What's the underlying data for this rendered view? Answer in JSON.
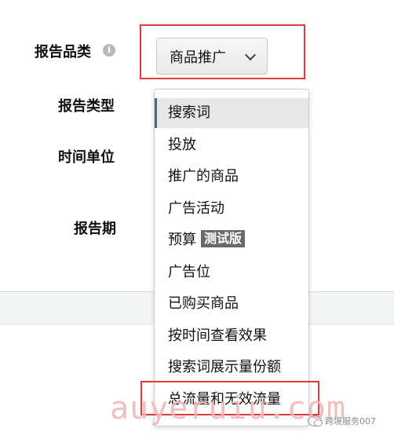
{
  "form": {
    "category_label": "报告品类",
    "type_label": "报告类型",
    "time_unit_label": "时间单位",
    "period_label": "报告期",
    "info_icon": "info-icon",
    "selected_category": "商品推广"
  },
  "dropdown": {
    "options": [
      {
        "label": "搜索词",
        "badge": ""
      },
      {
        "label": "投放",
        "badge": ""
      },
      {
        "label": "推广的商品",
        "badge": ""
      },
      {
        "label": "广告活动",
        "badge": ""
      },
      {
        "label": "预算",
        "badge": "测试版"
      },
      {
        "label": "广告位",
        "badge": ""
      },
      {
        "label": "已购买商品",
        "badge": ""
      },
      {
        "label": "按时间查看效果",
        "badge": ""
      },
      {
        "label": "搜索词展示量份额",
        "badge": ""
      },
      {
        "label": "总流量和无效流量",
        "badge": ""
      }
    ],
    "selected_index": 0
  },
  "overlay": {
    "watermark": "auyeruiu.com",
    "account": "跨境服务007"
  },
  "colors": {
    "highlight_border": "#e23b3b",
    "selected_bg": "#e7e7e7",
    "badge_bg": "#6a6a6a"
  }
}
